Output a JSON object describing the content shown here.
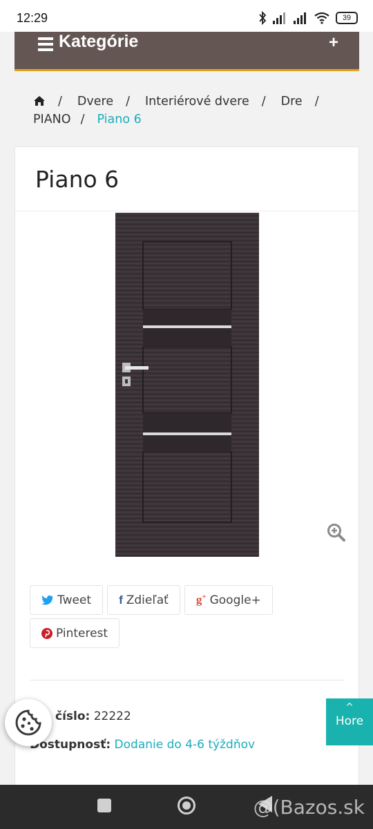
{
  "status_bar": {
    "time": "12:29",
    "battery": "39",
    "icons": [
      "bluetooth-icon",
      "signal-icon",
      "signal-icon",
      "wifi-icon",
      "battery-icon"
    ]
  },
  "category_bar": {
    "title": "Kategórie",
    "expand_symbol": "+"
  },
  "breadcrumb": {
    "items": [
      "Dvere",
      "Interiérové dvere",
      "Dre",
      "PIANO"
    ],
    "current": "Piano 6",
    "separator": "/"
  },
  "product": {
    "title": "Piano 6",
    "image_icon": "door-image",
    "zoom_icon": "zoom-in-icon"
  },
  "share": {
    "buttons": [
      {
        "icon": "twitter-icon",
        "label": "Tweet"
      },
      {
        "icon": "facebook-icon",
        "label": "Zdieľať"
      },
      {
        "icon": "google-plus-icon",
        "label": "Google+"
      },
      {
        "icon": "pinterest-icon",
        "label": "Pinterest"
      }
    ]
  },
  "details": {
    "code_label": "číslo:",
    "code_value": "22222",
    "availability_label": "Dostupnosť:",
    "availability_value": "Dodanie do 4-6 týždňov"
  },
  "back_to_top": {
    "arrow": "^",
    "label": "Hore"
  },
  "watermark": "@(Bazos.sk",
  "colors": {
    "category_bar": "#645652",
    "accent_underline": "#e2a21d",
    "link": "#1aaebb",
    "top_button": "#1ab2ae",
    "door": "#3a3236"
  }
}
